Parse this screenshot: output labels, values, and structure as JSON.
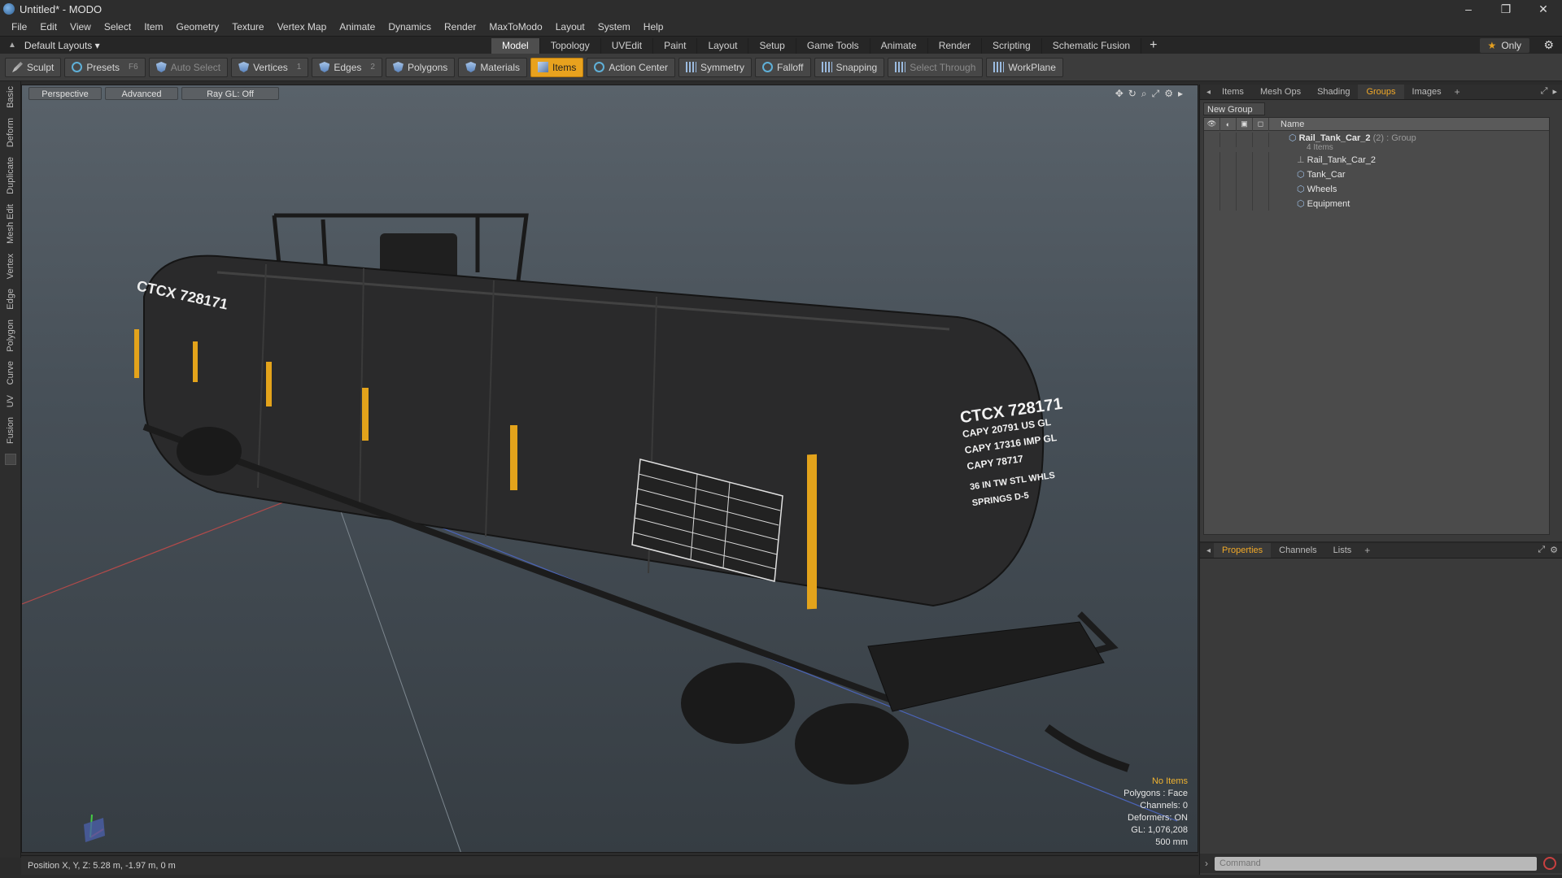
{
  "window": {
    "title": "Untitled* - MODO",
    "minimize": "–",
    "maximize": "❐",
    "close": "✕"
  },
  "menu": [
    "File",
    "Edit",
    "View",
    "Select",
    "Item",
    "Geometry",
    "Texture",
    "Vertex Map",
    "Animate",
    "Dynamics",
    "Render",
    "MaxToModo",
    "Layout",
    "System",
    "Help"
  ],
  "layouts": {
    "label": "Default Layouts ▾"
  },
  "tabs": [
    "Model",
    "Topology",
    "UVEdit",
    "Paint",
    "Layout",
    "Setup",
    "Game Tools",
    "Animate",
    "Render",
    "Scripting",
    "Schematic Fusion"
  ],
  "tabs_active": "Model",
  "only_label": "Only",
  "toolbar": {
    "sculpt": "Sculpt",
    "presets": "Presets",
    "presets_key": "F6",
    "auto_select": "Auto Select",
    "vertices": "Vertices",
    "vertices_key": "1",
    "edges": "Edges",
    "edges_key": "2",
    "polygons": "Polygons",
    "materials": "Materials",
    "items": "Items",
    "action_center": "Action Center",
    "symmetry": "Symmetry",
    "falloff": "Falloff",
    "snapping": "Snapping",
    "select_through": "Select Through",
    "workplane": "WorkPlane"
  },
  "left_tabs": [
    "Basic",
    "Deform",
    "Duplicate",
    "Mesh Edit",
    "Vertex",
    "Edge",
    "Polygon",
    "Curve",
    "UV",
    "Fusion"
  ],
  "viewport": {
    "view": "Perspective",
    "shading": "Advanced",
    "raygl": "Ray GL: Off",
    "stats": {
      "items": "No Items",
      "polygons": "Polygons : Face",
      "channels": "Channels: 0",
      "deformers": "Deformers: ON",
      "gl": "GL: 1,076,208",
      "scale": "500 mm"
    },
    "model": {
      "car_id": "CTCX 728171",
      "capy_lines": [
        "CAPY 20791 US GL",
        "CAPY 17316 IMP GL",
        "CAPY 78717"
      ],
      "spec_lines": [
        "36 IN TW STL WHLS",
        "SPRINGS D-5"
      ]
    }
  },
  "statusbar": {
    "position": "Position X, Y, Z:   5.28 m, -1.97 m, 0 m"
  },
  "right_tabs": [
    "Items",
    "Mesh Ops",
    "Shading",
    "Groups",
    "Images"
  ],
  "right_tabs_active": "Groups",
  "new_group": "New Group",
  "groups": {
    "name_header": "Name",
    "root": {
      "name": "Rail_Tank_Car_2",
      "count": "(2)",
      "type": ": Group",
      "sub": "4 Items"
    },
    "children": [
      "Rail_Tank_Car_2",
      "Tank_Car",
      "Wheels",
      "Equipment"
    ]
  },
  "bottom_tabs": [
    "Properties",
    "Channels",
    "Lists"
  ],
  "bottom_tabs_active": "Properties",
  "command_placeholder": "Command"
}
